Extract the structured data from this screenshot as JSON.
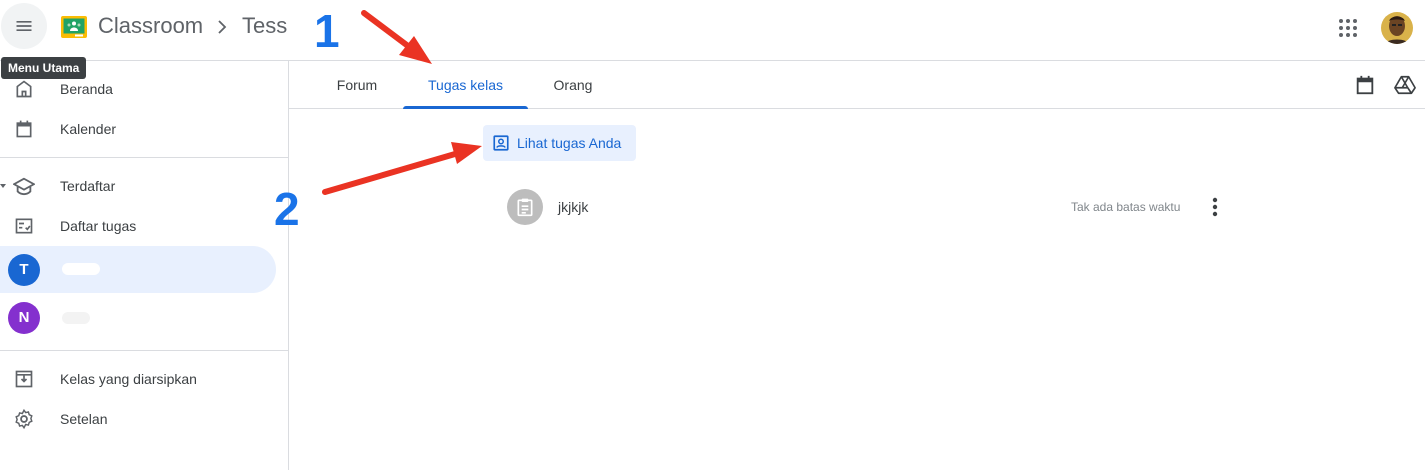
{
  "header": {
    "app_title": "Classroom",
    "class_title": "Tess",
    "menu_tooltip": "Menu Utama"
  },
  "sidebar": {
    "items": [
      {
        "label": "Beranda",
        "icon": "home-icon"
      },
      {
        "label": "Kalender",
        "icon": "calendar-icon"
      },
      {
        "label": "Terdaftar",
        "icon": "school-icon"
      },
      {
        "label": "Daftar tugas",
        "icon": "checklist-icon"
      },
      {
        "avatar_letter": "T",
        "avatar_color": "#1967d2"
      },
      {
        "avatar_letter": "N",
        "avatar_color": "#8430ce"
      },
      {
        "label": "Kelas yang diarsipkan",
        "icon": "archive-icon"
      },
      {
        "label": "Setelan",
        "icon": "gear-icon"
      }
    ]
  },
  "tabs": [
    {
      "label": "Forum"
    },
    {
      "label": "Tugas kelas",
      "active": true
    },
    {
      "label": "Orang"
    }
  ],
  "content": {
    "view_button_label": "Lihat tugas Anda",
    "assignments": [
      {
        "title": "jkjkjk",
        "due": "Tak ada batas waktu",
        "icon": "assignment-icon"
      }
    ]
  },
  "annotations": {
    "step1": "1",
    "step2": "2"
  },
  "colors": {
    "accent": "#1967d2",
    "active_bg": "#e8f0fe",
    "arrow": "#ea3323",
    "annotation_number": "#1a73e8"
  }
}
